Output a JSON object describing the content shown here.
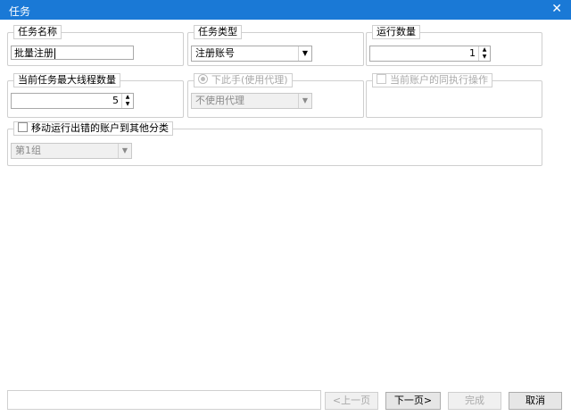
{
  "window": {
    "title": "任务"
  },
  "task_name": {
    "label": "任务名称",
    "value": "批量注册"
  },
  "task_type": {
    "label": "任务类型",
    "selected": "注册账号"
  },
  "run_count": {
    "label": "运行数量",
    "value": "1"
  },
  "max_threads": {
    "label": "当前任务最大线程数量",
    "value": "5"
  },
  "proxy": {
    "label": "下此手(使用代理)",
    "selected": "不使用代理"
  },
  "same_account": {
    "label": "当前账户的同执行操作"
  },
  "move_failed": {
    "label": "移动运行出错的账户到其他分类",
    "selected": "第1组"
  },
  "buttons": {
    "prev": "<上一页",
    "next": "下一页>",
    "finish": "完成",
    "cancel": "取消"
  }
}
